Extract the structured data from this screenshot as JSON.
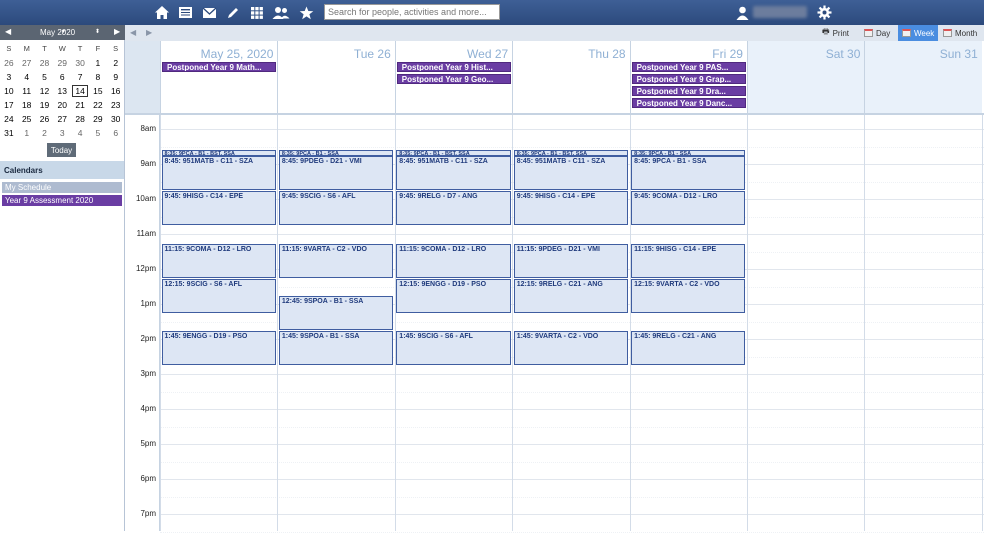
{
  "topbar": {
    "icons": [
      "home-icon",
      "newspaper-icon",
      "mail-icon",
      "pencil-icon",
      "apps-grid-icon",
      "people-icon",
      "star-icon",
      "user-icon",
      "gear-icon"
    ],
    "search_placeholder": "Search for people, activities and more..."
  },
  "mini_calendar": {
    "month_label": "May 2020",
    "dow": [
      "S",
      "M",
      "T",
      "W",
      "T",
      "F",
      "S"
    ],
    "weeks": [
      [
        {
          "d": "26",
          "o": true
        },
        {
          "d": "27",
          "o": true
        },
        {
          "d": "28",
          "o": true
        },
        {
          "d": "29",
          "o": true
        },
        {
          "d": "30",
          "o": true
        },
        {
          "d": "1"
        },
        {
          "d": "2"
        }
      ],
      [
        {
          "d": "3"
        },
        {
          "d": "4"
        },
        {
          "d": "5"
        },
        {
          "d": "6"
        },
        {
          "d": "7"
        },
        {
          "d": "8"
        },
        {
          "d": "9"
        }
      ],
      [
        {
          "d": "10"
        },
        {
          "d": "11"
        },
        {
          "d": "12"
        },
        {
          "d": "13"
        },
        {
          "d": "14",
          "t": true
        },
        {
          "d": "15"
        },
        {
          "d": "16"
        }
      ],
      [
        {
          "d": "17"
        },
        {
          "d": "18"
        },
        {
          "d": "19"
        },
        {
          "d": "20"
        },
        {
          "d": "21"
        },
        {
          "d": "22"
        },
        {
          "d": "23"
        }
      ],
      [
        {
          "d": "24"
        },
        {
          "d": "25"
        },
        {
          "d": "26"
        },
        {
          "d": "27"
        },
        {
          "d": "28"
        },
        {
          "d": "29"
        },
        {
          "d": "30"
        }
      ],
      [
        {
          "d": "31"
        },
        {
          "d": "1",
          "o": true
        },
        {
          "d": "2",
          "o": true
        },
        {
          "d": "3",
          "o": true
        },
        {
          "d": "4",
          "o": true
        },
        {
          "d": "5",
          "o": true
        },
        {
          "d": "6",
          "o": true
        }
      ]
    ],
    "today_label": "Today"
  },
  "calendars": {
    "heading": "Calendars",
    "items": [
      {
        "label": "My Schedule",
        "color": "#aebbd0"
      },
      {
        "label": "Year 9 Assessment 2020",
        "color": "#6a3da3"
      }
    ]
  },
  "toolbar": {
    "print_label": "Print",
    "day_label": "Day",
    "week_label": "Week",
    "month_label": "Month",
    "active_view": "Week"
  },
  "days": [
    {
      "label": "May 25, 2020",
      "weekend": false,
      "allday": [
        "Postponed Year 9 Math..."
      ]
    },
    {
      "label": "Tue 26",
      "weekend": false,
      "allday": []
    },
    {
      "label": "Wed 27",
      "weekend": false,
      "allday": [
        "Postponed Year 9 Hist...",
        "Postponed Year 9 Geo..."
      ]
    },
    {
      "label": "Thu 28",
      "weekend": false,
      "allday": []
    },
    {
      "label": "Fri 29",
      "weekend": false,
      "allday": [
        "Postponed Year 9 PAS...",
        "Postponed Year 9 Grap...",
        "Postponed Year 9 Dra...",
        "Postponed Year 9 Danc..."
      ]
    },
    {
      "label": "Sat 30",
      "weekend": true,
      "allday": []
    },
    {
      "label": "Sun 31",
      "weekend": true,
      "allday": []
    }
  ],
  "hours": [
    "8am",
    "9am",
    "10am",
    "11am",
    "12pm",
    "1pm",
    "2pm",
    "3pm",
    "4pm",
    "5pm",
    "6pm",
    "7pm"
  ],
  "events": [
    {
      "day": 0,
      "start": "8:35",
      "end": "8:45",
      "title": "8:35: 9PCA - B1 - BST, SSA"
    },
    {
      "day": 0,
      "start": "8:45",
      "end": "9:45",
      "title": "8:45: 951MATB - C11 - SZA"
    },
    {
      "day": 0,
      "start": "9:45",
      "end": "10:45",
      "title": "9:45: 9HISG - C14 - EPE"
    },
    {
      "day": 0,
      "start": "11:15",
      "end": "12:15",
      "title": "11:15: 9COMA - D12 - LRO"
    },
    {
      "day": 0,
      "start": "12:15",
      "end": "13:15",
      "title": "12:15: 9SCIG - S6 - AFL"
    },
    {
      "day": 0,
      "start": "13:45",
      "end": "14:45",
      "title": "1:45: 9ENGG - D19 - PSO"
    },
    {
      "day": 1,
      "start": "8:35",
      "end": "8:45",
      "title": "8:35: 9PCA - B1 - SSA"
    },
    {
      "day": 1,
      "start": "8:45",
      "end": "9:45",
      "title": "8:45: 9PDEG - D21 - VMI"
    },
    {
      "day": 1,
      "start": "9:45",
      "end": "10:45",
      "title": "9:45: 9SCIG - S6 - AFL"
    },
    {
      "day": 1,
      "start": "11:15",
      "end": "12:15",
      "title": "11:15: 9VARTA - C2 - VDO"
    },
    {
      "day": 1,
      "start": "12:45",
      "end": "13:45",
      "title": "12:45: 9SPOA - B1 - SSA"
    },
    {
      "day": 1,
      "start": "13:45",
      "end": "14:45",
      "title": "1:45: 9SPOA - B1 - SSA"
    },
    {
      "day": 2,
      "start": "8:35",
      "end": "8:45",
      "title": "8:35: 9PCA - B1 - BST, SSA"
    },
    {
      "day": 2,
      "start": "8:45",
      "end": "9:45",
      "title": "8:45: 951MATB - C11 - SZA"
    },
    {
      "day": 2,
      "start": "9:45",
      "end": "10:45",
      "title": "9:45: 9RELG - D7 - ANG"
    },
    {
      "day": 2,
      "start": "11:15",
      "end": "12:15",
      "title": "11:15: 9COMA - D12 - LRO"
    },
    {
      "day": 2,
      "start": "12:15",
      "end": "13:15",
      "title": "12:15: 9ENGG - D19 - PSO"
    },
    {
      "day": 2,
      "start": "13:45",
      "end": "14:45",
      "title": "1:45: 9SCIG - S6 - AFL"
    },
    {
      "day": 3,
      "start": "8:35",
      "end": "8:45",
      "title": "8:35: 9PCA - B1 - BST, SSA"
    },
    {
      "day": 3,
      "start": "8:45",
      "end": "9:45",
      "title": "8:45: 951MATB - C11 - SZA"
    },
    {
      "day": 3,
      "start": "9:45",
      "end": "10:45",
      "title": "9:45: 9HISG - C14 - EPE"
    },
    {
      "day": 3,
      "start": "11:15",
      "end": "12:15",
      "title": "11:15: 9PDEG - D21 - VMI"
    },
    {
      "day": 3,
      "start": "12:15",
      "end": "13:15",
      "title": "12:15: 9RELG - C21 - ANG"
    },
    {
      "day": 3,
      "start": "13:45",
      "end": "14:45",
      "title": "1:45: 9VARTA - C2 - VDO"
    },
    {
      "day": 4,
      "start": "8:35",
      "end": "8:45",
      "title": "8:35: 9PCA - B1 - SSA"
    },
    {
      "day": 4,
      "start": "8:45",
      "end": "9:45",
      "title": "8:45: 9PCA - B1 - SSA"
    },
    {
      "day": 4,
      "start": "9:45",
      "end": "10:45",
      "title": "9:45: 9COMA - D12 - LRO"
    },
    {
      "day": 4,
      "start": "11:15",
      "end": "12:15",
      "title": "11:15: 9HISG - C14 - EPE"
    },
    {
      "day": 4,
      "start": "12:15",
      "end": "13:15",
      "title": "12:15: 9VARTA - C2 - VDO"
    },
    {
      "day": 4,
      "start": "13:45",
      "end": "14:45",
      "title": "1:45: 9RELG - C21 - ANG"
    }
  ]
}
